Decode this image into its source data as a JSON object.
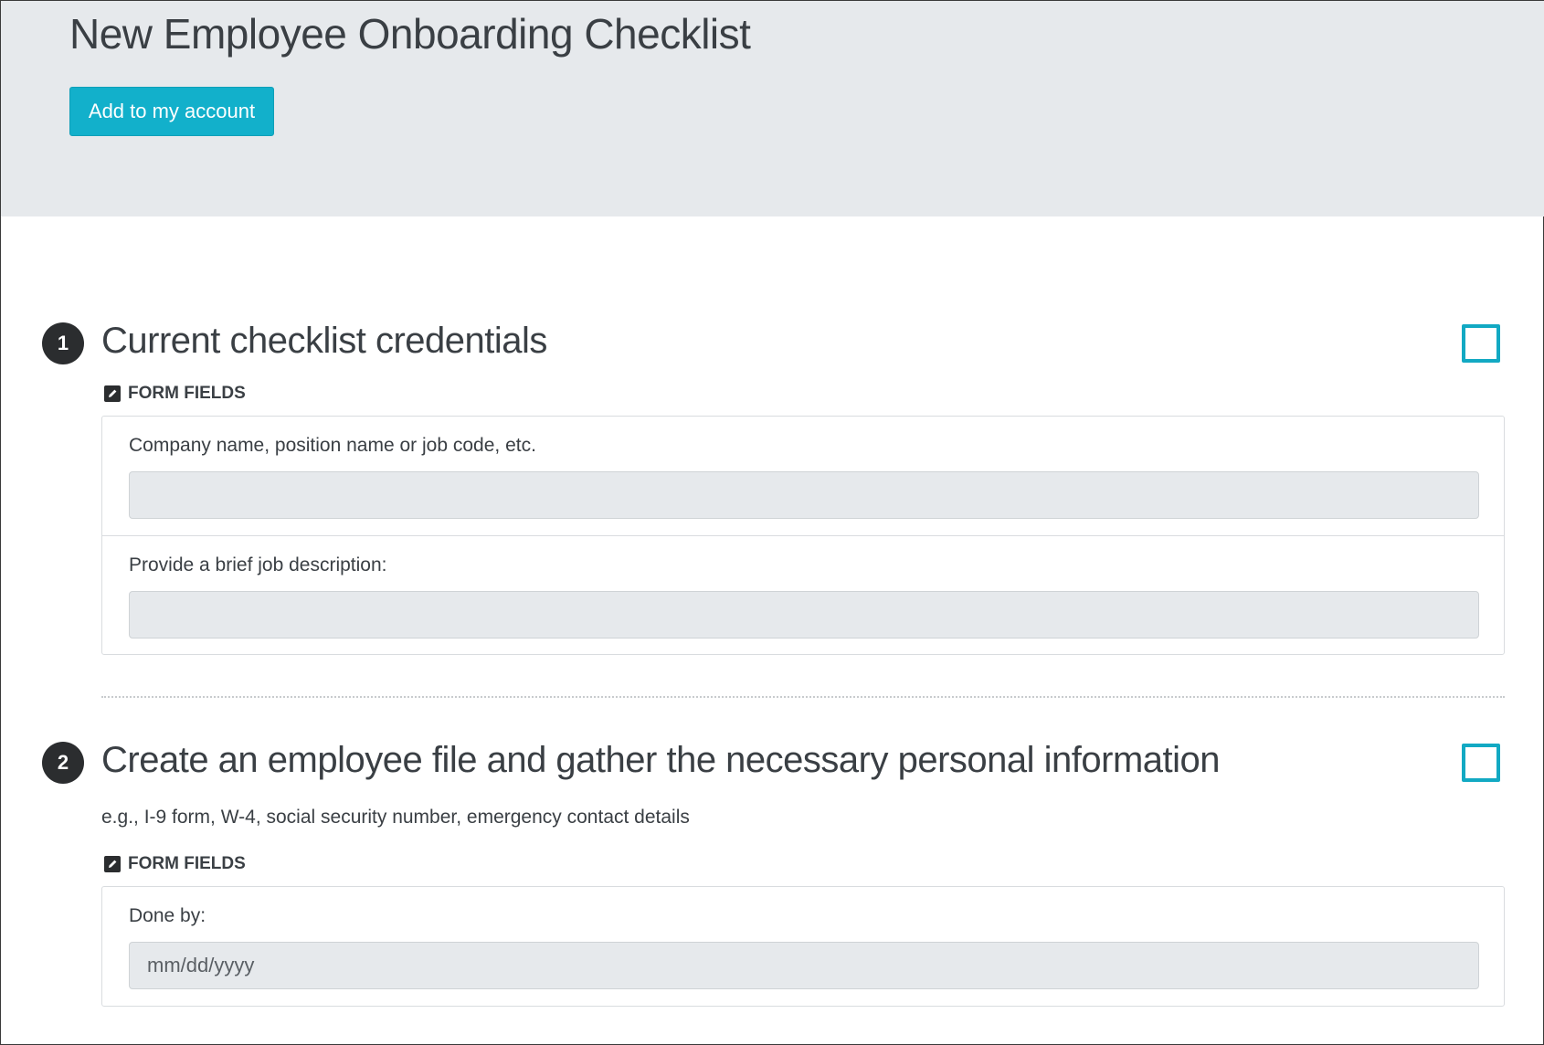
{
  "header": {
    "title": "New Employee Onboarding Checklist",
    "add_button_label": "Add to my account"
  },
  "steps": [
    {
      "number": "1",
      "title": "Current checklist credentials",
      "checked": false,
      "section_label": "FORM FIELDS",
      "fields": [
        {
          "label": "Company name, position name or job code, etc.",
          "value": "",
          "placeholder": ""
        },
        {
          "label": "Provide a brief job description:",
          "value": "",
          "placeholder": ""
        }
      ]
    },
    {
      "number": "2",
      "title": "Create an employee file and gather the necessary personal information",
      "description": "e.g., I-9 form, W-4, social security number, emergency contact details",
      "checked": false,
      "section_label": "FORM FIELDS",
      "fields": [
        {
          "label": "Done by:",
          "value": "",
          "placeholder": "mm/dd/yyyy"
        }
      ]
    }
  ],
  "colors": {
    "accent": "#12b0cb",
    "header_bg": "#e6e9ec",
    "text": "#3a3f44",
    "step_badge": "#2b2d2f"
  },
  "icons": {
    "section": "edit-icon"
  }
}
